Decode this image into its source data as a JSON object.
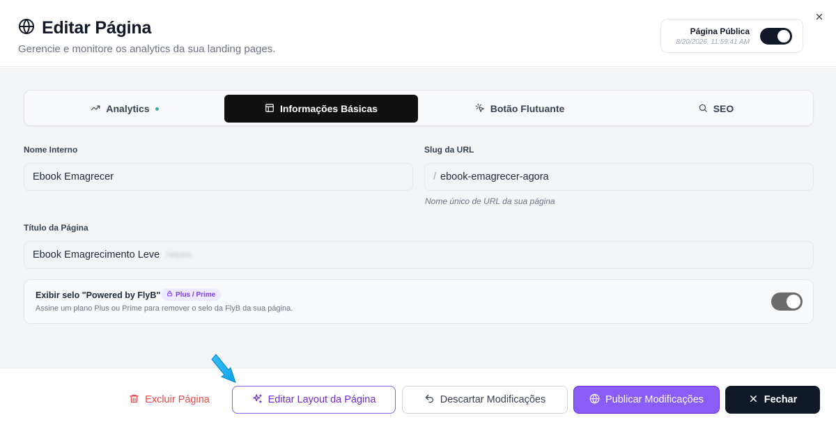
{
  "header": {
    "title": "Editar Página",
    "subtitle": "Gerencie e monitore os analytics da sua landing pages.",
    "public_label": "Página Pública",
    "public_date": "8/20/2026, 11:59:41 AM"
  },
  "tabs": [
    {
      "label": "Analytics",
      "icon": "trending-up-icon"
    },
    {
      "label": "Informações Básicas",
      "icon": "layout-icon",
      "active": true
    },
    {
      "label": "Botão Flutuante",
      "icon": "pointer-icon"
    },
    {
      "label": "SEO",
      "icon": "search-icon"
    }
  ],
  "form": {
    "internal_name_label": "Nome Interno",
    "internal_name_value": "Ebook Emagrecer",
    "slug_label": "Slug da URL",
    "slug_prefix": "/",
    "slug_value": "ebook-emagrecer-agora",
    "slug_help": "Nome único de URL da sua página",
    "page_title_label": "Título da Página",
    "page_title_value": "Ebook Emagrecimento Leve",
    "page_title_blurred": "Nayara"
  },
  "powered": {
    "title": "Exibir selo \"Powered by FlyB\"",
    "badge": "Plus / Prime",
    "description": "Assine um plano Plus ou Prime para remover o selo da FlyB da sua página."
  },
  "footer": {
    "delete_label": "Excluir Página",
    "edit_layout_label": "Editar Layout da Página",
    "discard_label": "Descartar Modificações",
    "publish_label": "Publicar Modificações",
    "close_label": "Fechar"
  },
  "colors": {
    "accent_purple": "#8b5cf6",
    "dark": "#111827",
    "danger": "#ef4444",
    "analytics_dot": "#2bb3a3"
  }
}
